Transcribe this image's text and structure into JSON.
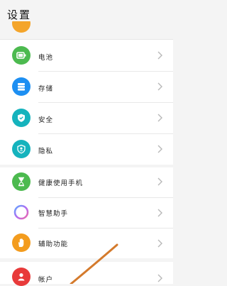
{
  "header": {
    "title": "设置"
  },
  "groups": [
    {
      "items": [
        {
          "label": "电池",
          "icon": "battery-icon",
          "color": "#4cba4f"
        },
        {
          "label": "存储",
          "icon": "storage-icon",
          "color": "#1d8ff2"
        },
        {
          "label": "安全",
          "icon": "shield-icon",
          "color": "#15b3bd"
        },
        {
          "label": "隐私",
          "icon": "privacy-icon",
          "color": "#15b3bd"
        }
      ]
    },
    {
      "items": [
        {
          "label": "健康使用手机",
          "icon": "hourglass-icon",
          "color": "#4cba4f"
        },
        {
          "label": "智慧助手",
          "icon": "assistant-ring-icon",
          "color": "#a86cf0"
        },
        {
          "label": "辅助功能",
          "icon": "hand-icon",
          "color": "#f39c1e"
        }
      ]
    },
    {
      "items": [
        {
          "label": "帐户",
          "icon": "user-icon",
          "color": "#e83a3a"
        }
      ]
    }
  ],
  "annotation": {
    "color": "#d47a2c"
  }
}
